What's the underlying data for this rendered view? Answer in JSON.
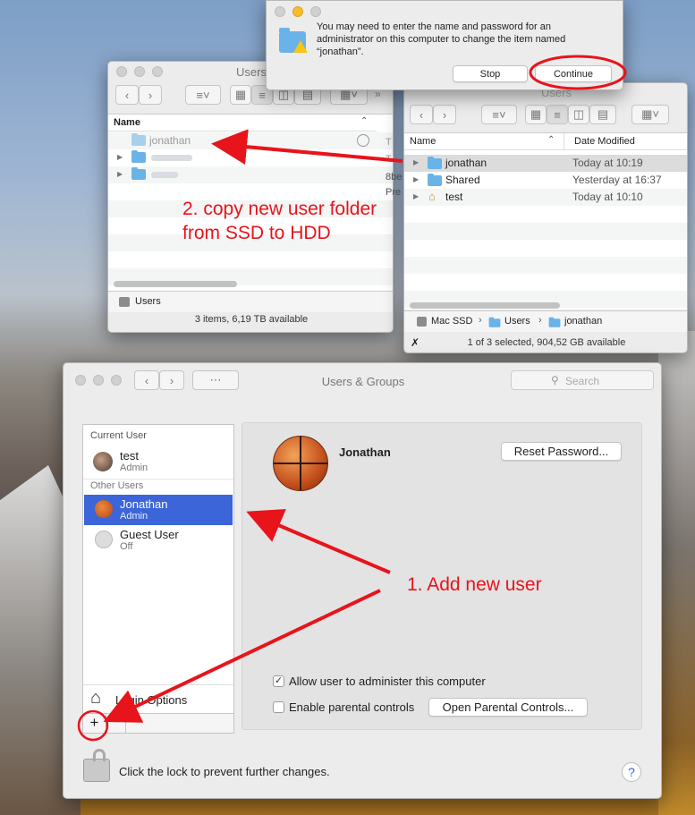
{
  "auth_dialog": {
    "message": "You may need to enter the name and password for an administrator on this computer to change the item named “jonathan”.",
    "stop_label": "Stop",
    "continue_label": "Continue"
  },
  "finder_left": {
    "title": "Users",
    "col_name": "Name",
    "rows": [
      "jonathan",
      "",
      ""
    ],
    "path_label": "Users",
    "status": "3 items, 6,19 TB available",
    "clipped_fragments": [
      "T",
      "T",
      "8be",
      "Pre"
    ]
  },
  "finder_right": {
    "title": "Users",
    "col_name": "Name",
    "col_date": "Date Modified",
    "rows": [
      {
        "name": "jonathan",
        "date": "Today at 10:19"
      },
      {
        "name": "Shared",
        "date": "Yesterday at 16:37"
      },
      {
        "name": "test",
        "date": "Today at 10:10"
      }
    ],
    "path": [
      "Mac SSD",
      "Users",
      "jonathan"
    ],
    "status": "1 of 3 selected, 904,52 GB available"
  },
  "annotations": {
    "step2_line1": "2. copy new user folder",
    "step2_line2": "from SSD to HDD",
    "step1": "1. Add new user"
  },
  "users_groups": {
    "title": "Users & Groups",
    "search_placeholder": "Search",
    "current_user_header": "Current User",
    "other_users_header": "Other Users",
    "current_user": {
      "name": "test",
      "role": "Admin"
    },
    "other_users": [
      {
        "name": "Jonathan",
        "role": "Admin"
      },
      {
        "name": "Guest User",
        "role": "Off"
      }
    ],
    "login_options": "Login Options",
    "selected_name": "Jonathan",
    "reset_password": "Reset Password...",
    "allow_admin_label": "Allow user to administer this computer",
    "allow_admin_checked": true,
    "parental_label": "Enable parental controls",
    "parental_checked": false,
    "open_parental": "Open Parental Controls...",
    "lock_text": "Click the lock to prevent further changes.",
    "add_symbol": "+",
    "remove_symbol": "−",
    "help_symbol": "?"
  },
  "colors": {
    "selection": "#3b65d8",
    "annotation_red": "#e8141b",
    "folder_blue": "#6ab3e9"
  }
}
